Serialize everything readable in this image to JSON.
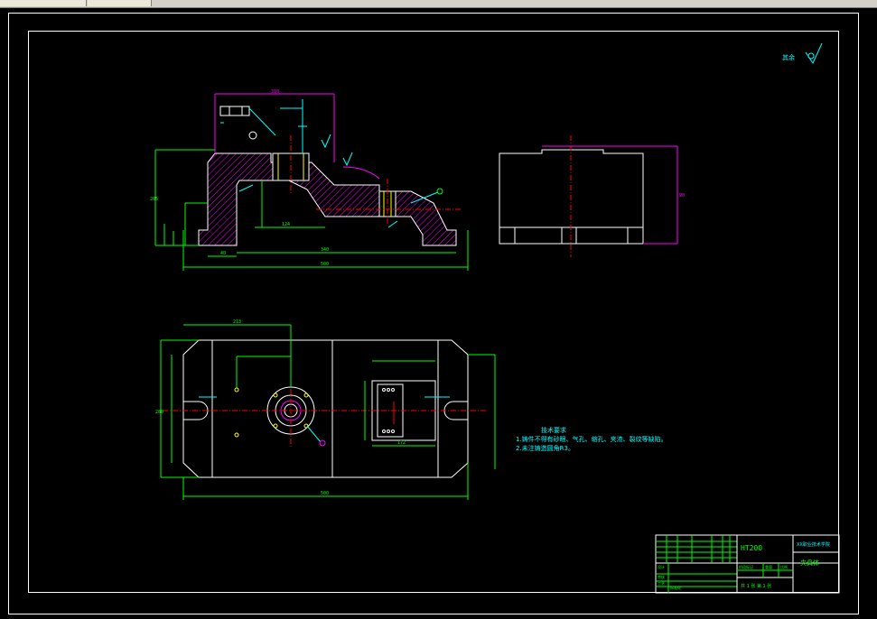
{
  "window": {
    "tabs": [
      "",
      ""
    ]
  },
  "drawing": {
    "roughness_symbol_label": "其余",
    "tech_requirements": {
      "title": "技术要求",
      "items": [
        "1.铸件不得有砂眼、气孔、缩孔、夹渣、裂纹等缺陷。",
        "2.未注铸造圆角R3。"
      ]
    },
    "title_block": {
      "material": "HT200",
      "school": "XX职业技术学院",
      "part_name": "夹具体",
      "sheet_info": "共 1 张   第 1 张",
      "scale_label": "比例",
      "weight_label": "重量",
      "stage_label": "阶段标记",
      "design_label": "设计",
      "check_label": "审核",
      "process_label": "工艺",
      "standard_label": "标准化"
    },
    "dims": {
      "front_top": "310",
      "front_height": "205",
      "front_total": "500",
      "front_inner": "340",
      "front_left": "40",
      "front_mid": "124",
      "plan_total": "500",
      "plan_top": "213",
      "plan_height": "280",
      "plan_right": "172",
      "side_height": "90"
    },
    "colors": {
      "outline": "#ffffff",
      "dimension": "#00ff00",
      "center": "#ff0000",
      "hatch": "#ff00ff",
      "leader": "#00ffff",
      "hole": "#ffff00"
    }
  }
}
